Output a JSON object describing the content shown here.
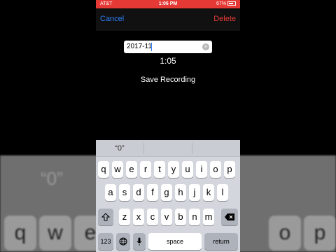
{
  "status_bar": {
    "carrier": "AT&T",
    "time": "1:06 PM",
    "battery": "67%"
  },
  "nav": {
    "cancel": "Cancel",
    "delete": "Delete"
  },
  "recording": {
    "name_value": "2017-11",
    "duration": "1:05",
    "save_label": "Save Recording"
  },
  "keyboard": {
    "prediction": "“0”",
    "row1": [
      "q",
      "w",
      "e",
      "r",
      "t",
      "y",
      "u",
      "i",
      "o",
      "p"
    ],
    "row2": [
      "a",
      "s",
      "d",
      "f",
      "g",
      "h",
      "j",
      "k",
      "l"
    ],
    "row3": [
      "z",
      "x",
      "c",
      "v",
      "b",
      "n",
      "m"
    ],
    "numbers_key": "123",
    "space_key": "space",
    "return_key": "return"
  },
  "backdrop": {
    "hint": "“0”",
    "left_keys": [
      "q",
      "w",
      "e"
    ],
    "right_keys": [
      "o",
      "p"
    ]
  },
  "colors": {
    "status_bar": "#e53935",
    "accent": "#2f7df6",
    "delete": "#e53935"
  }
}
